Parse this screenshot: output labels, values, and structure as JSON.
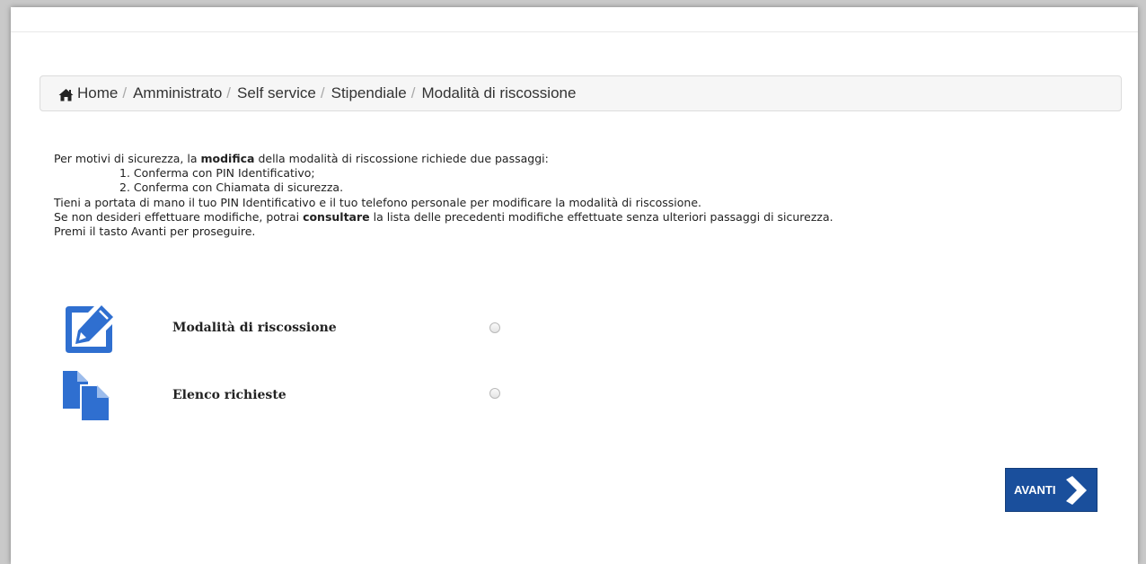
{
  "breadcrumb": {
    "items": [
      "Home",
      "Amministrato",
      "Self service",
      "Stipendiale"
    ],
    "current": "Modalità di riscossione",
    "separator": "/"
  },
  "intro": {
    "line1_a": "Per motivi di sicurezza, la ",
    "line1_b": "modifica",
    "line1_c": " della modalità di riscossione richiede due passaggi:",
    "step1": "1. Conferma con PIN Identificativo;",
    "step2": "2. Conferma con Chiamata di sicurezza.",
    "line2": "Tieni a portata di mano il tuo PIN Identificativo e il tuo telefono personale per modificare la modalità di riscossione.",
    "line3_a": "Se non desideri effettuare modifiche, potrai ",
    "line3_b": "consultare",
    "line3_c": " la lista delle precedenti modifiche effettuate senza ulteriori passaggi di sicurezza.",
    "line4": "Premi il tasto Avanti per proseguire."
  },
  "options": [
    {
      "label": "Modalità di riscossione",
      "icon": "edit-icon",
      "selected": false
    },
    {
      "label": "Elenco richieste",
      "icon": "documents-icon",
      "selected": false
    }
  ],
  "button": {
    "label": "AVANTI",
    "icon": "chevron-right-icon"
  },
  "colors": {
    "accent": "#1a4f9c",
    "icon_blue": "#2f6fd0"
  }
}
